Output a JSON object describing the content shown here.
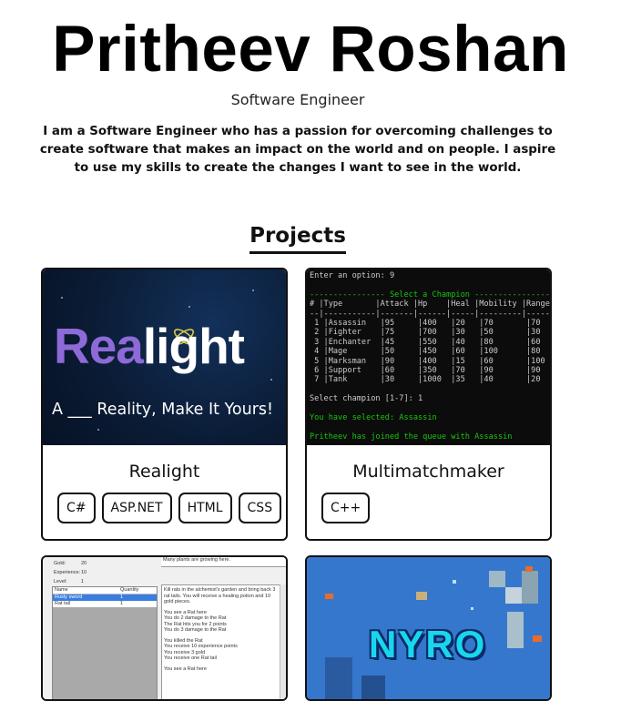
{
  "header": {
    "name": "Pritheev Roshan",
    "role": "Software Engineer",
    "bio": "I am a Software Engineer who has a passion for overcoming challenges to create software that makes an impact on the world and on people. I aspire to use my skills to create the changes I want to see in the world."
  },
  "projects": {
    "heading": "Projects",
    "items": [
      {
        "title": "Realight",
        "image_logo_part1": "Rea",
        "image_logo_part2": "light",
        "image_tagline": "A ___ Reality, Make It Yours!",
        "tags": [
          "C#",
          "ASP.NET",
          "HTML",
          "CSS"
        ]
      },
      {
        "title": "Multimatchmaker",
        "tags": [
          "C++"
        ],
        "console": {
          "prompt": "Enter an option: 9",
          "section_title": "---------------- Select a Champion ----------------",
          "header": "# |Type       |Attack |Hp    |Heal |Mobility |Range",
          "rule": "--|-----------|-------|------|-----|---------|-----",
          "rows": [
            " 1 |Assassin   |95     |400   |20   |70       |70",
            " 2 |Fighter    |75     |700   |30   |50       |30",
            " 3 |Enchanter  |45     |550   |40   |80       |60",
            " 4 |Mage       |50     |450   |60   |100      |80",
            " 5 |Marksman   |90     |400   |15   |60       |100",
            " 6 |Support    |60     |350   |70   |90       |90",
            " 7 |Tank       |30     |1000  |35   |40       |20"
          ],
          "select": "Select champion [1-7]: 1",
          "selected": "You have selected: Assassin",
          "joined": "Pritheev has joined the queue with Assassin"
        }
      },
      {
        "game": {
          "gold_label": "Gold:",
          "gold_value": "20",
          "exp_label": "Experience:",
          "exp_value": "10",
          "level_label": "Level:",
          "level_value": "1",
          "col_name": "Name",
          "col_qty": "Quantity",
          "items": [
            {
              "name": "Rusty sword",
              "qty": "1"
            },
            {
              "name": "Rat tail",
              "qty": "1"
            }
          ],
          "log": [
            "Many plants are growing here.",
            "",
            "Kill rats in the alchemist's garden and bring back 3 rat tails. You will receive a healing potion and 10 gold pieces.",
            "",
            "You see a Rat here",
            "You do 2 damage to the Rat",
            "The Rat hits you for 2 points",
            "You do 3 damage to the Rat",
            "",
            "You killed the Rat",
            "You receive 10 experience points",
            "You receive 3 gold",
            "You receive one Rat tail",
            "",
            "You see a Rat here"
          ]
        }
      },
      {
        "image_logo": "NYRO"
      }
    ]
  }
}
